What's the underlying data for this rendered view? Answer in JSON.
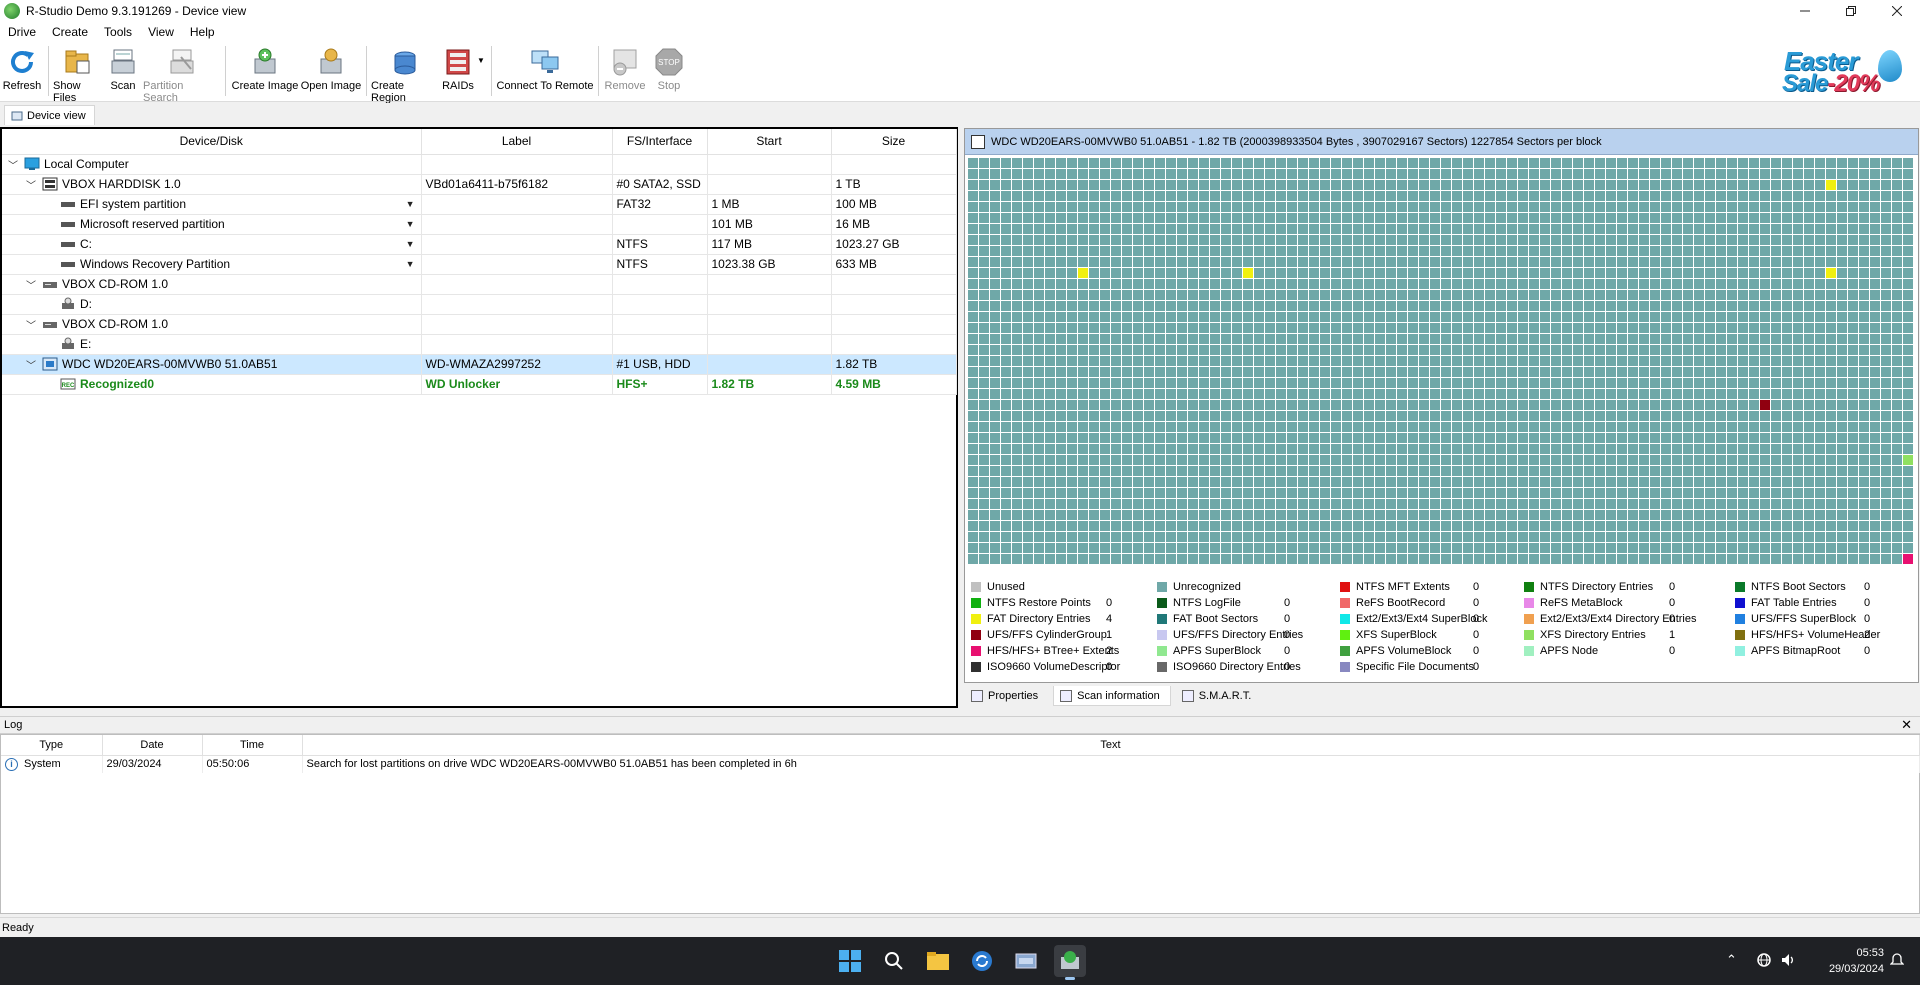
{
  "window": {
    "title": "R-Studio Demo 9.3.191269 - Device view"
  },
  "menu": [
    "Drive",
    "Create",
    "Tools",
    "View",
    "Help"
  ],
  "toolbar": {
    "refresh": "Refresh",
    "show_files": "Show Files",
    "scan": "Scan",
    "partition_search": "Partition Search",
    "create_image": "Create Image",
    "open_image": "Open Image",
    "create_region": "Create Region",
    "raids": "RAIDs",
    "connect_remote": "Connect To Remote",
    "remove": "Remove",
    "stop": "Stop",
    "stop_badge": "STOP"
  },
  "promo": {
    "line1": "Easter",
    "line2": "Sale",
    "discount": "-20%"
  },
  "tab": {
    "device_view": "Device view"
  },
  "tree": {
    "columns": [
      "Device/Disk",
      "Label",
      "FS/Interface",
      "Start",
      "Size"
    ],
    "rows": [
      {
        "name": "Local Computer",
        "label": "",
        "fs": "",
        "start": "",
        "size": ""
      },
      {
        "name": "VBOX HARDDISK 1.0",
        "label": "VBd01a6411-b75f6182",
        "fs": "#0 SATA2, SSD",
        "start": "",
        "size": "1 TB"
      },
      {
        "name": "EFI system partition",
        "label": "",
        "fs": "FAT32",
        "start": "1 MB",
        "size": "100 MB"
      },
      {
        "name": "Microsoft reserved partition",
        "label": "",
        "fs": "",
        "start": "101 MB",
        "size": "16 MB"
      },
      {
        "name": "C:",
        "label": "",
        "fs": "NTFS",
        "start": "117 MB",
        "size": "1023.27 GB"
      },
      {
        "name": "Windows Recovery Partition",
        "label": "",
        "fs": "NTFS",
        "start": "1023.38 GB",
        "size": "633 MB"
      },
      {
        "name": "VBOX CD-ROM 1.0",
        "label": "",
        "fs": "",
        "start": "",
        "size": ""
      },
      {
        "name": "D:",
        "label": "",
        "fs": "",
        "start": "",
        "size": ""
      },
      {
        "name": "VBOX CD-ROM 1.0",
        "label": "",
        "fs": "",
        "start": "",
        "size": ""
      },
      {
        "name": "E:",
        "label": "",
        "fs": "",
        "start": "",
        "size": ""
      },
      {
        "name": "WDC WD20EARS-00MVWB0 51.0AB51",
        "label": "WD-WMAZA2997252",
        "fs": "#1 USB, HDD",
        "start": "",
        "size": "1.82 TB"
      },
      {
        "name": "Recognized0",
        "label": "WD Unlocker",
        "fs": "HFS+",
        "start": "1.82 TB",
        "size": "4.59 MB"
      }
    ]
  },
  "map": {
    "header": "WDC WD20EARS-00MVWB0 51.0AB51 - 1.82 TB (2000398933504 Bytes , 3907029167 Sectors) 1227854 Sectors per block",
    "legend": [
      {
        "label": "Unused",
        "count": "",
        "color": "#c0c0c0"
      },
      {
        "label": "Unrecognized",
        "count": "",
        "color": "#6fa8a8"
      },
      {
        "label": "NTFS MFT Extents",
        "count": "0",
        "color": "#e01010"
      },
      {
        "label": "NTFS Directory Entries",
        "count": "0",
        "color": "#108010"
      },
      {
        "label": "NTFS Boot Sectors",
        "count": "0",
        "color": "#0a7a2a"
      },
      {
        "label": "NTFS Restore Points",
        "count": "0",
        "color": "#10b010"
      },
      {
        "label": "NTFS LogFile",
        "count": "0",
        "color": "#0a5a1a"
      },
      {
        "label": "ReFS BootRecord",
        "count": "0",
        "color": "#f06868"
      },
      {
        "label": "ReFS MetaBlock",
        "count": "0",
        "color": "#e888e8"
      },
      {
        "label": "FAT Table Entries",
        "count": "0",
        "color": "#1010d0"
      },
      {
        "label": "FAT Directory Entries",
        "count": "4",
        "color": "#f0f010"
      },
      {
        "label": "FAT Boot Sectors",
        "count": "0",
        "color": "#207878"
      },
      {
        "label": "Ext2/Ext3/Ext4 SuperBlock",
        "count": "0",
        "color": "#10e8e8"
      },
      {
        "label": "Ext2/Ext3/Ext4 Directory Entries",
        "count": "0",
        "color": "#f0a050"
      },
      {
        "label": "UFS/FFS SuperBlock",
        "count": "0",
        "color": "#2080e0"
      },
      {
        "label": "UFS/FFS CylinderGroup",
        "count": "1",
        "color": "#900010"
      },
      {
        "label": "UFS/FFS Directory Entries",
        "count": "0",
        "color": "#c8c8f0"
      },
      {
        "label": "XFS SuperBlock",
        "count": "0",
        "color": "#60f010"
      },
      {
        "label": "XFS Directory Entries",
        "count": "1",
        "color": "#90e060"
      },
      {
        "label": "HFS/HFS+ VolumeHeader",
        "count": "2",
        "color": "#807010"
      },
      {
        "label": "HFS/HFS+ BTree+ Extents",
        "count": "2",
        "color": "#e81070"
      },
      {
        "label": "APFS SuperBlock",
        "count": "0",
        "color": "#90e890"
      },
      {
        "label": "APFS VolumeBlock",
        "count": "0",
        "color": "#40a040"
      },
      {
        "label": "APFS Node",
        "count": "0",
        "color": "#a0f0c0"
      },
      {
        "label": "APFS BitmapRoot",
        "count": "0",
        "color": "#90f0e0"
      },
      {
        "label": "ISO9660 VolumeDescriptor",
        "count": "0",
        "color": "#303030"
      },
      {
        "label": "ISO9660 Directory Entries",
        "count": "0",
        "color": "#686868"
      },
      {
        "label": "Specific File Documents",
        "count": "0",
        "color": "#8888c0"
      }
    ]
  },
  "bottom_tabs": [
    "Properties",
    "Scan information",
    "S.M.A.R.T."
  ],
  "log": {
    "title": "Log",
    "close": "✕",
    "columns": [
      "Type",
      "Date",
      "Time",
      "Text"
    ],
    "rows": [
      {
        "type": "System",
        "date": "29/03/2024",
        "time": "05:50:06",
        "text": "Search for lost partitions on drive WDC WD20EARS-00MVWB0 51.0AB51 has been completed in 6h"
      }
    ]
  },
  "status": "Ready",
  "clock": {
    "time": "05:53",
    "date": "29/03/2024"
  }
}
